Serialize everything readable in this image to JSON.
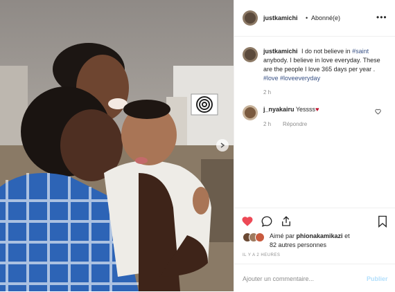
{
  "post": {
    "username": "justkamichi",
    "separator": "•",
    "follow_status": "Abonné(e)",
    "more_label": "•••"
  },
  "caption": {
    "username": "justkamichi",
    "text_before": "I do not believe in",
    "hashtag1": "#saint",
    "text_after": "anybody. I believe in love everyday. These are the people I love 365 days per year .",
    "hashtag2": "#love",
    "hashtag3": "#loveeveryday",
    "time": "2 h"
  },
  "comment": {
    "username": "j_nyakairu",
    "text": "Yessss",
    "emoji": "♥",
    "time": "2 h",
    "reply_label": "Répondre"
  },
  "likes": {
    "prefix": "Aimé par",
    "user": "phionakamikazi",
    "conj": "et",
    "others": "82 autres personnes"
  },
  "timestamp": "IL Y A 2 HEURES",
  "comment_box": {
    "placeholder": "Ajouter un commentaire...",
    "publish_label": "Publier"
  },
  "colors": {
    "heart": "#ed4956",
    "link": "#385185",
    "muted": "#8e8e8e",
    "publish_disabled": "#b2dffc"
  }
}
